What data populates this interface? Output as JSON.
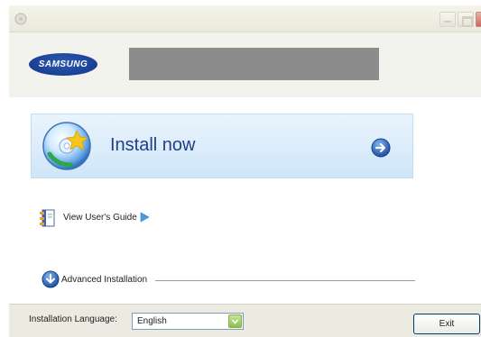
{
  "titlebar": {
    "icons": [
      "app-icon",
      "minimize-icon",
      "maximize-icon",
      "close-icon"
    ]
  },
  "header": {
    "logo_text": "SAMSUNG"
  },
  "install": {
    "label": "Install now",
    "icons": [
      "install-disc-icon",
      "arrow-right-circle-icon"
    ]
  },
  "guide": {
    "label": "View User's Guide",
    "icons": [
      "book-icon",
      "triangle-right-icon"
    ]
  },
  "advanced": {
    "label": "Advanced Installation",
    "icons": [
      "download-arrow-icon"
    ]
  },
  "footer": {
    "language_label": "Installation Language:",
    "language_value": "English",
    "exit_label": "Exit"
  },
  "colors": {
    "brand": "#1a429c",
    "install_panel": "#d8ebfa",
    "install_text": "#1f3f86",
    "footer_bg": "#ecebe2"
  }
}
